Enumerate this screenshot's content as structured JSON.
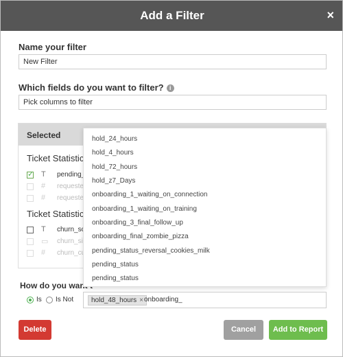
{
  "dialog": {
    "title": "Add a Filter",
    "close_glyph": "×"
  },
  "name_section": {
    "label": "Name your filter",
    "value": "New Filter"
  },
  "fields_section": {
    "label": "Which fields do you want to filter?",
    "info_glyph": "i",
    "value": "Pick columns to filter"
  },
  "columns_panel": {
    "header": "Selected",
    "groups": [
      {
        "title": "Ticket Statistics",
        "rows": [
          {
            "type_glyph": "T",
            "name": "pending_s",
            "checked": true,
            "disabled": false
          },
          {
            "type_glyph": "#",
            "name": "requester_",
            "checked": false,
            "disabled": true
          },
          {
            "type_glyph": "#",
            "name": "requester_",
            "checked": false,
            "disabled": true
          }
        ]
      },
      {
        "title": "Ticket Statistics",
        "rows": [
          {
            "type_glyph": "T",
            "name": "churn_sch",
            "checked": false,
            "disabled": false
          },
          {
            "type_glyph": "▭",
            "name": "churn_sig",
            "checked": false,
            "disabled": true
          },
          {
            "type_glyph": "#",
            "name": "churn_cus",
            "checked": false,
            "disabled": true
          }
        ]
      }
    ]
  },
  "dropdown": {
    "options": [
      "hold_24_hours",
      "hold_4_hours",
      "hold_72_hours",
      "hold_z7_Days",
      "onboarding_1_waiting_on_connection",
      "onboarding_1_waiting_on_training",
      "onboarding_3_final_follow_up",
      "onboarding_final_zombie_pizza",
      "pending_status_reversal_cookies_milk",
      "pending_status",
      "pending_status"
    ]
  },
  "filter_section": {
    "label": "How do you want t",
    "radio_is": "Is",
    "radio_is_not": "Is Not",
    "selected_radio": "Is",
    "chip_value": "hold_48_hours",
    "chip_remove_glyph": "×",
    "typed_text": "onboarding_"
  },
  "buttons": {
    "delete": "Delete",
    "cancel": "Cancel",
    "add": "Add to Report"
  },
  "colors": {
    "header_bg": "#565656",
    "delete": "#d33a32",
    "cancel": "#a0a0a0",
    "add": "#6ebd4e",
    "check": "#4caf50"
  }
}
